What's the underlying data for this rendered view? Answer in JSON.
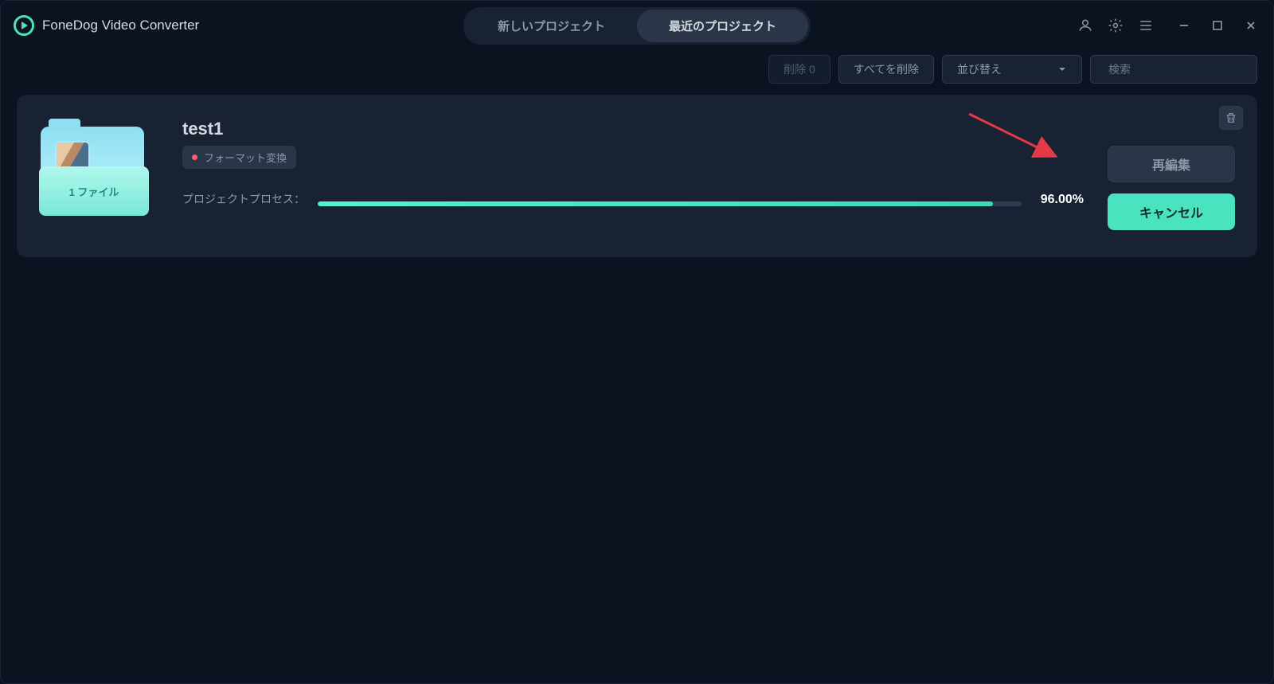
{
  "header": {
    "app_title": "FoneDog Video Converter",
    "tabs": {
      "new": "新しいプロジェクト",
      "recent": "最近のプロジェクト"
    }
  },
  "toolbar": {
    "delete_label": "削除 0",
    "delete_all": "すべてを削除",
    "sort_label": "並び替え",
    "search_placeholder": "検索"
  },
  "project": {
    "title": "test1",
    "file_count": "1 ファイル",
    "badge": "フォーマット変換",
    "process_label": "プロジェクトプロセス：",
    "percent_value": 96.0,
    "percent_text": "96.00%",
    "reedit": "再編集",
    "cancel": "キャンセル"
  },
  "colors": {
    "accent": "#49e3c0"
  }
}
